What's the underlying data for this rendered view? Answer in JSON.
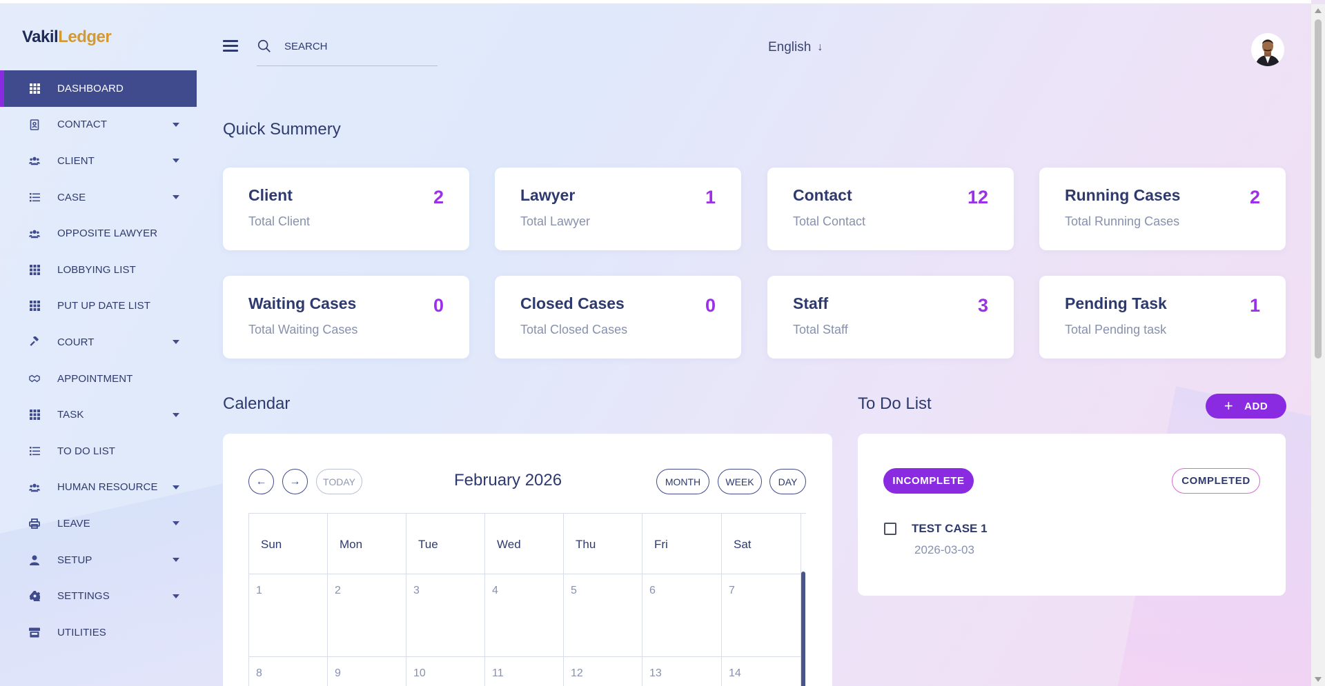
{
  "brand": {
    "part1": "Vakil",
    "part2": "Ledger"
  },
  "sidebar": {
    "items": [
      {
        "label": "DASHBOARD",
        "icon": "grid-icon",
        "active": true,
        "caret": false
      },
      {
        "label": "CONTACT",
        "icon": "contact-book-icon",
        "active": false,
        "caret": true
      },
      {
        "label": "CLIENT",
        "icon": "users-icon",
        "active": false,
        "caret": true
      },
      {
        "label": "CASE",
        "icon": "list-icon",
        "active": false,
        "caret": true
      },
      {
        "label": "OPPOSITE LAWYER",
        "icon": "users-icon",
        "active": false,
        "caret": false
      },
      {
        "label": "LOBBYING LIST",
        "icon": "grid-icon",
        "active": false,
        "caret": false
      },
      {
        "label": "PUT UP DATE LIST",
        "icon": "grid-icon",
        "active": false,
        "caret": false
      },
      {
        "label": "COURT",
        "icon": "gavel-icon",
        "active": false,
        "caret": true
      },
      {
        "label": "APPOINTMENT",
        "icon": "handshake-icon",
        "active": false,
        "caret": false
      },
      {
        "label": "TASK",
        "icon": "grid-icon",
        "active": false,
        "caret": true
      },
      {
        "label": "TO DO LIST",
        "icon": "list-icon",
        "active": false,
        "caret": false
      },
      {
        "label": "HUMAN RESOURCE",
        "icon": "users-icon",
        "active": false,
        "caret": true
      },
      {
        "label": "LEAVE",
        "icon": "printer-icon",
        "active": false,
        "caret": true
      },
      {
        "label": "SETUP",
        "icon": "user-icon",
        "active": false,
        "caret": true
      },
      {
        "label": "SETTINGS",
        "icon": "gear-icon",
        "active": false,
        "caret": true
      },
      {
        "label": "UTILITIES",
        "icon": "store-icon",
        "active": false,
        "caret": false
      }
    ]
  },
  "header": {
    "search_placeholder": "SEARCH",
    "language": "English"
  },
  "summary": {
    "title": "Quick Summery",
    "cards": [
      {
        "title": "Client",
        "subtitle": "Total Client",
        "value": "2"
      },
      {
        "title": "Lawyer",
        "subtitle": "Total Lawyer",
        "value": "1"
      },
      {
        "title": "Contact",
        "subtitle": "Total Contact",
        "value": "12"
      },
      {
        "title": "Running Cases",
        "subtitle": "Total Running Cases",
        "value": "2"
      },
      {
        "title": "Waiting Cases",
        "subtitle": "Total Waiting Cases",
        "value": "0"
      },
      {
        "title": "Closed Cases",
        "subtitle": "Total Closed Cases",
        "value": "0"
      },
      {
        "title": "Staff",
        "subtitle": "Total Staff",
        "value": "3"
      },
      {
        "title": "Pending Task",
        "subtitle": "Total Pending task",
        "value": "1"
      }
    ]
  },
  "calendar": {
    "title": "Calendar",
    "month_label": "February 2026",
    "today_label": "TODAY",
    "view_buttons": [
      "MONTH",
      "WEEK",
      "DAY"
    ],
    "weekdays": [
      "Sun",
      "Mon",
      "Tue",
      "Wed",
      "Thu",
      "Fri",
      "Sat"
    ],
    "weeks": [
      [
        "1",
        "2",
        "3",
        "4",
        "5",
        "6",
        "7"
      ],
      [
        "8",
        "9",
        "10",
        "11",
        "12",
        "13",
        "14"
      ]
    ]
  },
  "todo": {
    "title": "To Do List",
    "add_label": "ADD",
    "tab_incomplete": "INCOMPLETE",
    "tab_completed": "COMPLETED",
    "items": [
      {
        "title": "TEST CASE 1",
        "date": "2026-03-03",
        "checked": false
      }
    ]
  },
  "colors": {
    "accent": "#8a2be2",
    "sidebar_active": "#3f4b8c",
    "text_primary": "#2e3a6e",
    "text_muted": "#8791ad"
  }
}
